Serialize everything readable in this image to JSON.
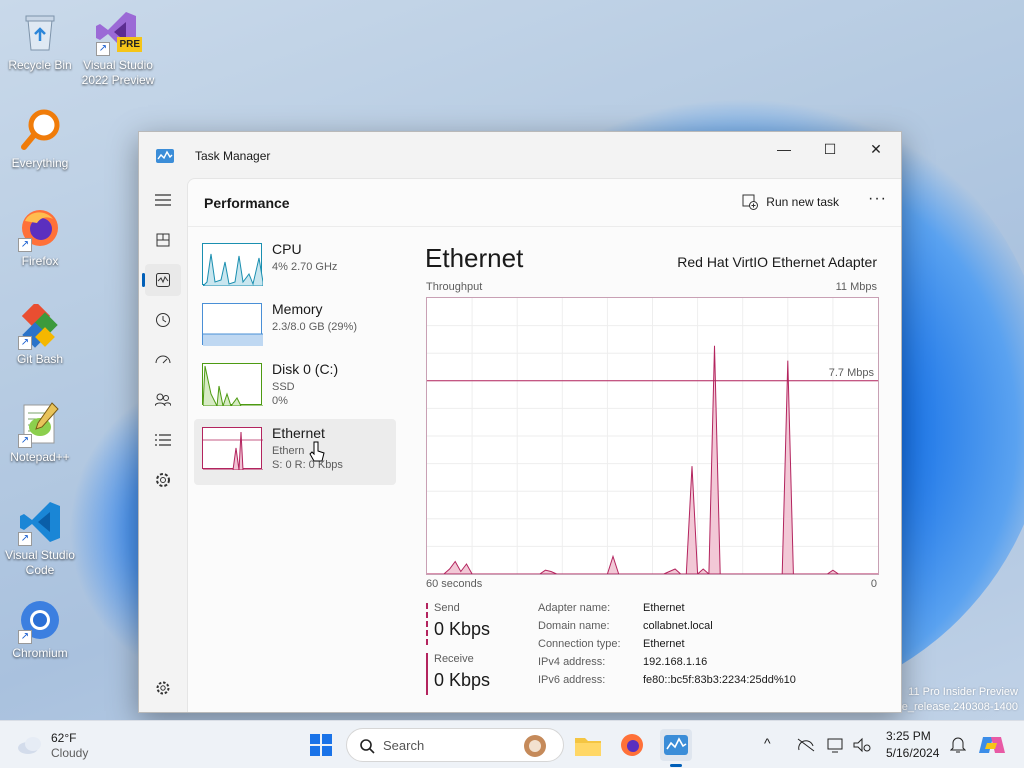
{
  "desktop": {
    "icons": [
      {
        "label": "Recycle Bin",
        "icon": "recycle-bin-icon"
      },
      {
        "label": "Visual Studio 2022 Preview",
        "icon": "visual-studio-icon",
        "badge": "PRE"
      },
      {
        "label": "Everything",
        "icon": "everything-search-icon"
      },
      {
        "label": "Firefox",
        "icon": "firefox-icon"
      },
      {
        "label": "Git Bash",
        "icon": "git-bash-icon"
      },
      {
        "label": "Notepad++",
        "icon": "notepad-plus-plus-icon"
      },
      {
        "label": "Visual Studio Code",
        "icon": "vscode-icon"
      },
      {
        "label": "Chromium",
        "icon": "chromium-icon"
      }
    ],
    "watermark_line1": "11 Pro Insider Preview",
    "watermark_line2": "e_release.240308-1400"
  },
  "window": {
    "title": "Task Manager",
    "controls": {
      "minimize": "—",
      "maximize": "☐",
      "close": "✕"
    }
  },
  "header": {
    "page_title": "Performance",
    "run_new_task": "Run new task",
    "more": "···"
  },
  "perf_list": [
    {
      "name": "CPU",
      "sub1": "4%  2.70 GHz",
      "color": "#1a8fb0"
    },
    {
      "name": "Memory",
      "sub1": "2.3/8.0 GB (29%)",
      "color": "#4a8fd6"
    },
    {
      "name": "Disk 0 (C:)",
      "sub1": "SSD",
      "sub2": "0%",
      "color": "#4d9a12"
    },
    {
      "name": "Ethernet",
      "sub1": "Ethern",
      "sub2": "S: 0  R: 0 Kbps",
      "color": "#b3245e"
    }
  ],
  "detail": {
    "title": "Ethernet",
    "adapter": "Red Hat VirtIO Ethernet Adapter",
    "throughput_label": "Throughput",
    "max_label": "11 Mbps",
    "line_label": "7.7 Mbps",
    "x_left": "60 seconds",
    "x_right": "0",
    "send_label": "Send",
    "send_value": "0 Kbps",
    "receive_label": "Receive",
    "receive_value": "0 Kbps",
    "properties": [
      {
        "key": "Adapter name:",
        "value": "Ethernet"
      },
      {
        "key": "Domain name:",
        "value": "collabnet.local"
      },
      {
        "key": "Connection type:",
        "value": "Ethernet"
      },
      {
        "key": "IPv4 address:",
        "value": "192.168.1.16"
      },
      {
        "key": "IPv6 address:",
        "value": "fe80::bc5f:83b3:2234:25dd%10"
      }
    ]
  },
  "chart_data": {
    "type": "area",
    "title": "Throughput",
    "xlabel": "60 seconds",
    "ylabel": "",
    "ylim": [
      0,
      11
    ],
    "reference_line": 7.7,
    "series": [
      {
        "values": [
          0,
          0,
          0,
          0,
          0.2,
          0.5,
          0.1,
          0.4,
          0,
          0,
          0,
          0,
          0,
          0,
          0,
          0,
          0,
          0,
          0,
          0,
          0,
          0.15,
          0.1,
          0,
          0,
          0,
          0,
          0,
          0,
          0,
          0,
          0,
          0,
          0.7,
          0,
          0,
          0,
          0,
          0,
          0,
          0,
          0,
          0,
          0.1,
          0.2,
          0,
          0,
          4.3,
          0,
          0.2,
          0,
          9.1,
          0,
          0,
          0,
          0,
          0,
          0,
          0,
          0,
          0,
          0,
          0,
          0,
          8.5,
          0,
          0,
          0,
          0,
          0,
          0,
          0,
          0.15,
          0,
          0,
          0,
          0,
          0,
          0,
          0,
          0
        ]
      }
    ]
  },
  "taskbar": {
    "weather_temp": "62°F",
    "weather_desc": "Cloudy",
    "search_placeholder": "Search",
    "time": "3:25 PM",
    "date": "5/16/2024",
    "tray_chevron": "^"
  }
}
